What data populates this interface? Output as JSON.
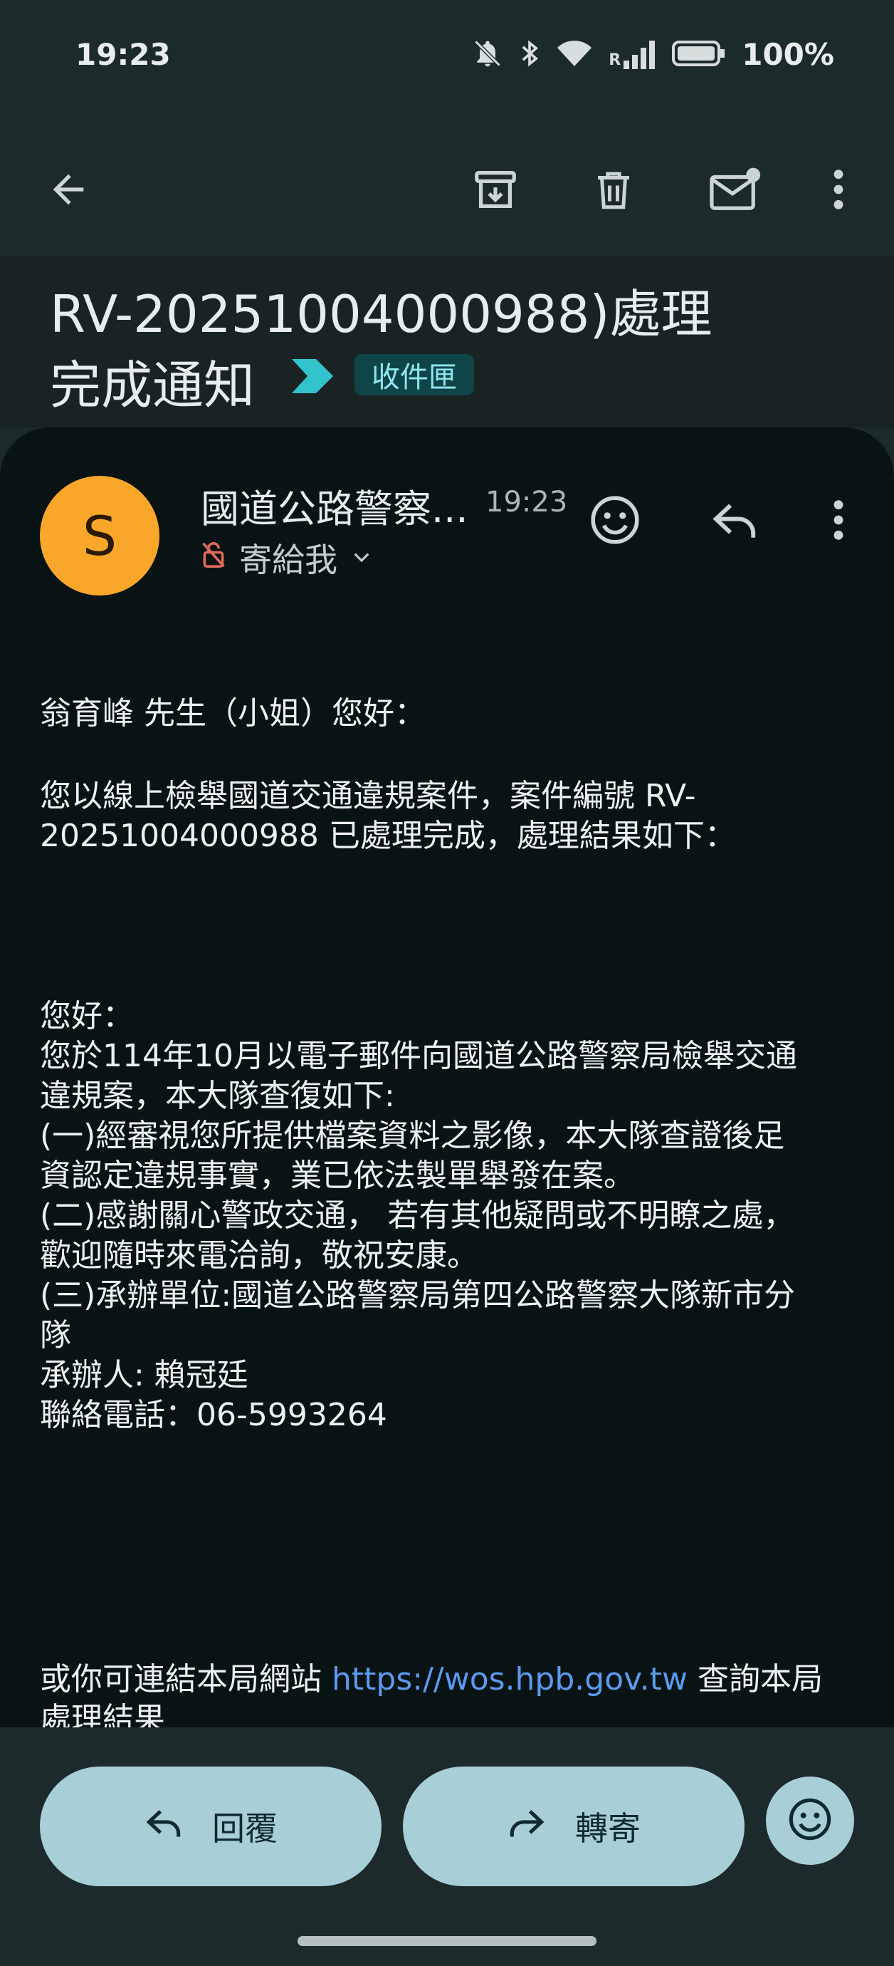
{
  "status": {
    "time": "19:23",
    "battery": "100%",
    "network_label": "R"
  },
  "toolbar": {
    "back": "back-arrow-icon",
    "archive": "archive-icon",
    "delete": "trash-icon",
    "mark_unread": "mark-unread-icon",
    "more": "more-vert-icon"
  },
  "subject": {
    "line1": "RV-20251004000988)處理",
    "line2": "完成通知",
    "label": "收件匣"
  },
  "header": {
    "avatar_letter": "S",
    "sender": "國道公路警察...",
    "time": "19:23",
    "to": "寄給我"
  },
  "body": {
    "lines": [
      "翁育峰 先生（小姐）您好：",
      "您以線上檢舉國道交通違規案件，案件編號 RV-",
      "20251004000988 已處理完成，處理結果如下：",
      "您好：",
      "您於114年10月以電子郵件向國道公路警察局檢舉交通",
      "違規案，本大隊查復如下:",
      "(一)經審視您所提供檔案資料之影像，本大隊查證後足",
      "資認定違規事實，業已依法製單舉發在案。",
      "(二)感謝關心警政交通， 若有其他疑問或不明瞭之處，",
      "歡迎隨時來電洽詢，敬祝安康。",
      "(三)承辦單位:國道公路警察局第四公路警察大隊新市分",
      "隊",
      "承辦人: 賴冠廷",
      "聯絡電話：06-5993264"
    ],
    "link_prefix": "或你可連結本局網站 ",
    "link_url": "https://wos.hpb.gov.tw",
    "link_suffix": " 查詢本局",
    "last_line": "處理結果"
  },
  "actions": {
    "reply": "回覆",
    "forward": "轉寄"
  },
  "colors": {
    "avatar": "#f9a72a",
    "chip_bg": "#0f4548",
    "chip_text": "#8fe6ee",
    "link": "#5b9bf0",
    "pill": "#a8ced8"
  }
}
